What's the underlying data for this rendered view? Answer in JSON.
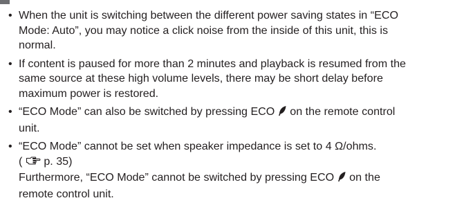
{
  "notes": [
    {
      "lines": [
        "When the unit is switching between the different power saving states in “ECO",
        "Mode: Auto”, you may notice a click noise from the inside of this unit, this is",
        "normal."
      ]
    },
    {
      "lines": [
        "If content is paused for more than 2 minutes and playback is resumed from the",
        "same source at these high volume levels, there may be short delay before",
        "maximum power is restored."
      ]
    },
    {
      "line1_before": "“ECO Mode” can also be switched by pressing ECO",
      "line1_after": "on the remote control",
      "line2": "unit."
    },
    {
      "line1": "“ECO Mode” cannot be set when speaker impedance is set to 4 Ω/ohms.",
      "ref_open": "(",
      "ref_page": "p. 35)",
      "line3_before": "Furthermore, “ECO Mode” cannot be switched by pressing ECO",
      "line3_after": "on the",
      "line4": "remote control unit."
    }
  ],
  "bullet": "•",
  "icons": {
    "eco": "leaf-icon",
    "reference": "pointing-hand-icon"
  }
}
